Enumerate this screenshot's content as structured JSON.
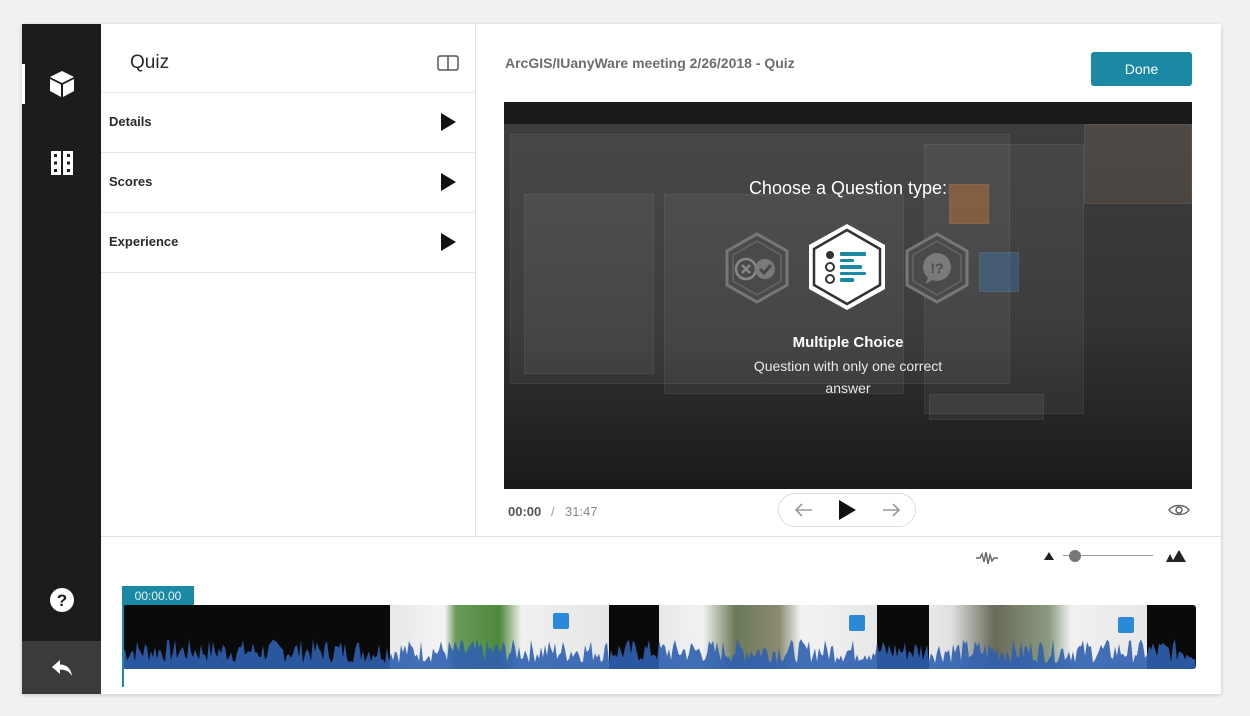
{
  "rail": {
    "items": [
      {
        "name": "quiz-builder-icon"
      },
      {
        "name": "film-strip-icon"
      }
    ],
    "help_icon": "question-circle-icon",
    "back_icon": "reply-icon"
  },
  "sidebar": {
    "title": "Quiz",
    "sections": [
      {
        "label": "Details"
      },
      {
        "label": "Scores"
      },
      {
        "label": "Experience"
      }
    ]
  },
  "header": {
    "title": "ArcGIS/IUanyWare meeting 2/26/2018 - Quiz",
    "done_label": "Done"
  },
  "video": {
    "overlay_title": "Choose a Question type:",
    "question_types": [
      {
        "icon": "true-false-icon",
        "selected": false
      },
      {
        "icon": "multiple-choice-icon",
        "selected": true
      },
      {
        "icon": "reflection-point-icon",
        "selected": false
      }
    ],
    "selected_type_name": "Multiple Choice",
    "selected_type_desc": "Question with only one correct answer"
  },
  "player": {
    "current_time": "00:00",
    "separator": "/",
    "total_time": "31:47"
  },
  "timeline": {
    "playhead_label": "00:00.00",
    "zoom_level": 0.08
  },
  "colors": {
    "accent": "#1b88a4",
    "rail": "#1c1c1c",
    "waveform": "#2f5fb0"
  }
}
